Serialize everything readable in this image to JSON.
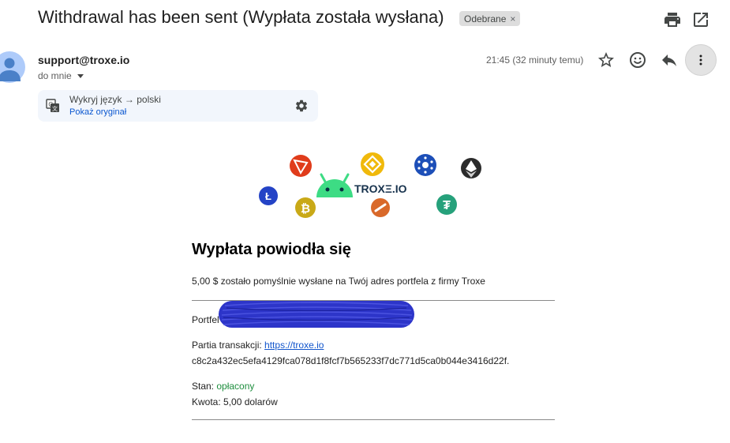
{
  "email": {
    "subject": "Withdrawal has been sent (Wypłata została wysłana)",
    "label": "Odebrane",
    "label_remove": "×",
    "sender": "support@troxe.io",
    "recipient": "do mnie",
    "timestamp": "21:45 (32 minuty temu)"
  },
  "translate": {
    "detect_text": "Wykryj język → polski",
    "show_original": "Pokaż oryginał"
  },
  "banner": {
    "logo_text": "TROXΞ.IO"
  },
  "body": {
    "heading": "Wypłata powiodła się",
    "intro": "5,00 $ zostało pomyślnie wysłane na Twój adres portfela z firmy Troxe",
    "wallet_label": "Portfel",
    "batch_label": "Partia transakcji: ",
    "batch_link": "https://troxe.io",
    "tx_hash": "c8c2a432ec5efa4129fca078d1f8fcf7b565233f7dc771d5ca0b044e3416d22f.",
    "status_label": "Stan: ",
    "status_value": "opłacony",
    "amount": "Kwota: 5,00 dolarów"
  },
  "icons": {
    "print": "print-icon",
    "open_new": "open-in-new-window-icon",
    "star": "star-icon",
    "emoji": "emoji-icon",
    "reply": "reply-icon",
    "more": "more-vert-icon",
    "translate": "translate-icon",
    "settings": "gear-icon"
  },
  "colors": {
    "link": "#1155cc",
    "status_paid": "#1e8e3e",
    "redaction": "#2d35c9",
    "android_green": "#3ddc84"
  }
}
